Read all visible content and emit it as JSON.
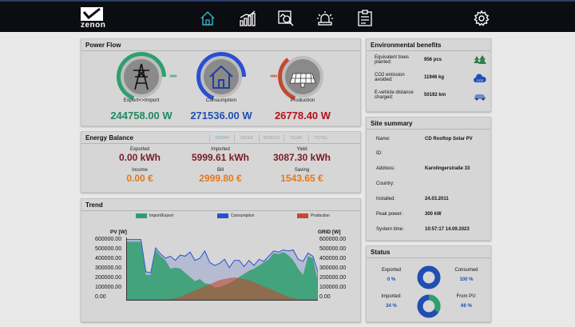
{
  "brand": {
    "name": "zenon"
  },
  "nav": [
    {
      "id": "home",
      "icon": "home-icon"
    },
    {
      "id": "trend",
      "icon": "bar-chart-icon"
    },
    {
      "id": "analysis",
      "icon": "chart-magnifier-icon"
    },
    {
      "id": "alarm",
      "icon": "siren-icon"
    },
    {
      "id": "report",
      "icon": "clipboard-icon"
    },
    {
      "id": "settings",
      "icon": "gear-icon"
    }
  ],
  "power_flow": {
    "title": "Power Flow",
    "grid": {
      "label": "Export<>Import",
      "value": "244758.00 W",
      "color": "#1f8a5f"
    },
    "consumption": {
      "label": "Consumption",
      "value": "271536.00 W",
      "color": "#1f4fb3"
    },
    "production": {
      "label": "Production",
      "value": "26778.40 W",
      "color": "#b5121b"
    },
    "arrows_left": "»»»",
    "arrows_right": "«««"
  },
  "energy_balance": {
    "title": "Energy Balance",
    "tabs": [
      "TODAY",
      "WEEK",
      "MONTH",
      "YEAR",
      "TOTAL"
    ],
    "active_tab": "TODAY",
    "exported": {
      "label": "Exported",
      "value": "0.00 kWh"
    },
    "imported": {
      "label": "Imported",
      "value": "5999.61 kWh"
    },
    "yield": {
      "label": "Yield",
      "value": "3087.30 kWh"
    },
    "income": {
      "label": "Income",
      "value": "0.00 €"
    },
    "bill": {
      "label": "Bill",
      "value": "2999.80 €"
    },
    "saving": {
      "label": "Saving",
      "value": "1543.65 €"
    }
  },
  "trend": {
    "title": "Trend",
    "legend": [
      {
        "name": "Import/Export",
        "color": "#2f9f6f"
      },
      {
        "name": "Consumption",
        "color": "#2a4fd1"
      },
      {
        "name": "Production",
        "color": "#c24a2e"
      }
    ],
    "left_axis_title": "PV [W]",
    "right_axis_title": "GRID [W]",
    "left_ticks": [
      "600000.00",
      "500000.00",
      "400000.00",
      "300000.00",
      "200000.00",
      "100000.00",
      "0.00"
    ],
    "right_ticks": [
      "600000.00",
      "500000.00",
      "400000.00",
      "300000.00",
      "200000.00",
      "100000.00",
      "0.00"
    ]
  },
  "chart_data": {
    "type": "area",
    "title": "",
    "ylabel": "PV [W]",
    "y2label": "GRID [W]",
    "ylim": [
      0,
      600000
    ],
    "x": [
      0,
      1,
      2,
      3,
      4,
      5,
      6,
      7,
      8,
      9,
      10,
      11,
      12,
      13,
      14,
      15,
      16,
      17,
      18,
      19,
      20,
      21,
      22,
      23,
      24,
      25,
      26,
      27,
      28,
      29,
      30,
      31,
      32,
      33,
      34,
      35,
      36,
      37,
      38,
      39
    ],
    "series": [
      {
        "name": "Import/Export",
        "values": [
          560000,
          560000,
          560000,
          560000,
          240000,
          240000,
          480000,
          420000,
          380000,
          300000,
          310000,
          300000,
          260000,
          220000,
          180000,
          200000,
          160000,
          150000,
          120000,
          120000,
          140000,
          160000,
          190000,
          220000,
          250000,
          280000,
          300000,
          330000,
          360000,
          390000,
          450000,
          440000,
          460000,
          430000,
          380000,
          300000,
          240000,
          420000,
          400000,
          180000
        ]
      },
      {
        "name": "Consumption",
        "values": [
          580000,
          580000,
          580000,
          580000,
          270000,
          260000,
          500000,
          440000,
          400000,
          420000,
          380000,
          430000,
          420000,
          460000,
          380000,
          400000,
          470000,
          360000,
          330000,
          350000,
          390000,
          310000,
          380000,
          380000,
          320000,
          380000,
          330000,
          390000,
          370000,
          420000,
          470000,
          460000,
          480000,
          470000,
          480000,
          390000,
          370000,
          450000,
          420000,
          270000
        ]
      },
      {
        "name": "Production",
        "values": [
          0,
          0,
          0,
          0,
          0,
          0,
          0,
          0,
          0,
          5000,
          15000,
          30000,
          50000,
          70000,
          90000,
          110000,
          130000,
          150000,
          170000,
          190000,
          200000,
          210000,
          215000,
          210000,
          200000,
          190000,
          170000,
          150000,
          130000,
          110000,
          90000,
          70000,
          50000,
          30000,
          15000,
          5000,
          0,
          0,
          0,
          0
        ]
      }
    ]
  },
  "environment": {
    "title": "Environmental benefits",
    "rows": [
      {
        "label": "Equivalent trees planted:",
        "value": "956 pcs",
        "icon": "trees-icon"
      },
      {
        "label": "CO2 emission avoided:",
        "value": "11946 kg",
        "icon": "co2-cloud-icon"
      },
      {
        "label": "E-vehicle distance charged:",
        "value": "50192 km",
        "icon": "car-icon"
      }
    ]
  },
  "site": {
    "title": "Site summary",
    "rows": [
      {
        "label": "Name:",
        "value": "CD Rooftop Solar PV"
      },
      {
        "label": "ID:",
        "value": ""
      },
      {
        "label": "Address:",
        "value": "Karolingerstraße 33"
      },
      {
        "label": "Country:",
        "value": ""
      },
      {
        "label": "Installed:",
        "value": "24.03.2011"
      },
      {
        "label": "Peak power:",
        "value": "300 kW"
      },
      {
        "label": "System time:",
        "value": "10:57:17 14.09.2023"
      }
    ]
  },
  "status": {
    "title": "Status",
    "exported": {
      "label": "Exported",
      "value": "0 %",
      "fraction": 0.0
    },
    "consumed": {
      "label": "Consumed",
      "value": "100 %",
      "fraction": 1.0
    },
    "imported": {
      "label": "Imported:",
      "value": "34 %",
      "fraction": 0.34
    },
    "from_pv": {
      "label": "From PV:",
      "value": "66 %",
      "fraction": 0.66
    }
  }
}
